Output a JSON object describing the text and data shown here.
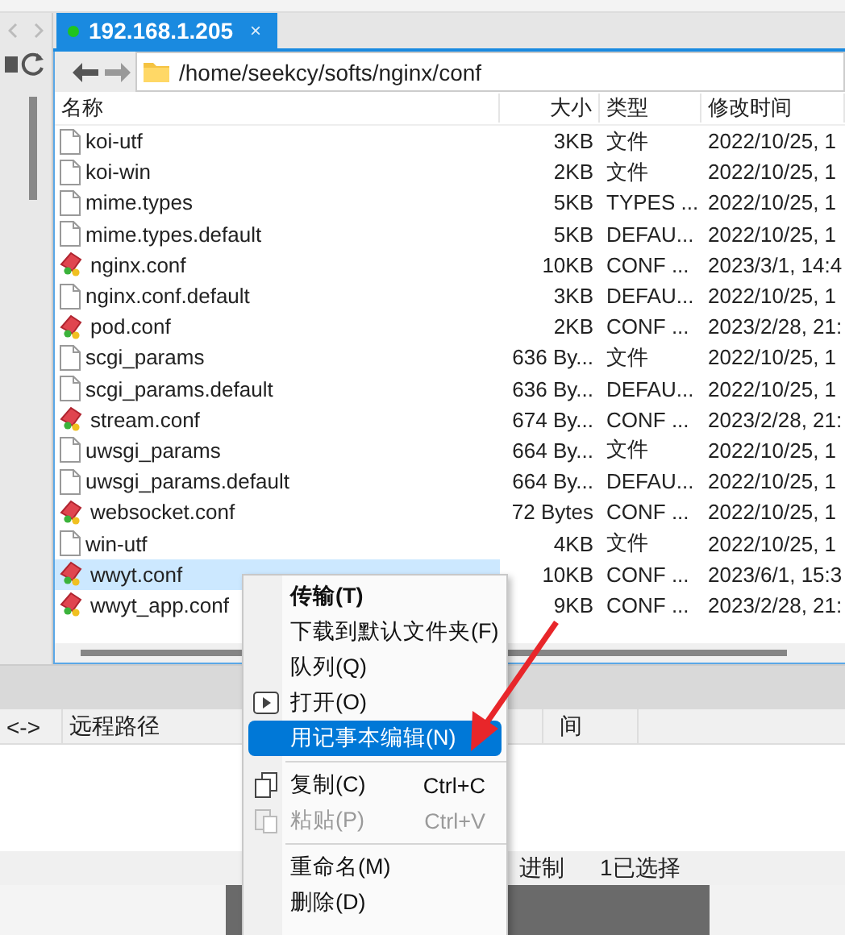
{
  "tab": {
    "title": "192.168.1.205",
    "connected": true,
    "close": "×"
  },
  "address": {
    "path": "/home/seekcy/softs/nginx/conf"
  },
  "table": {
    "columns": [
      "名称",
      "大小",
      "类型",
      "修改时间"
    ],
    "rows": [
      {
        "kind": "file",
        "name": "koi-utf",
        "size": "3KB",
        "type": "文件",
        "modified": "2022/10/25, 1",
        "selected": false
      },
      {
        "kind": "file",
        "name": "koi-win",
        "size": "2KB",
        "type": "文件",
        "modified": "2022/10/25, 1",
        "selected": false
      },
      {
        "kind": "file",
        "name": "mime.types",
        "size": "5KB",
        "type": "TYPES ...",
        "modified": "2022/10/25, 1",
        "selected": false
      },
      {
        "kind": "file",
        "name": "mime.types.default",
        "size": "5KB",
        "type": "DEFAU...",
        "modified": "2022/10/25, 1",
        "selected": false
      },
      {
        "kind": "conf",
        "name": "nginx.conf",
        "size": "10KB",
        "type": "CONF ...",
        "modified": "2023/3/1, 14:4",
        "selected": false
      },
      {
        "kind": "file",
        "name": "nginx.conf.default",
        "size": "3KB",
        "type": "DEFAU...",
        "modified": "2022/10/25, 1",
        "selected": false
      },
      {
        "kind": "conf",
        "name": "pod.conf",
        "size": "2KB",
        "type": "CONF ...",
        "modified": "2023/2/28, 21:",
        "selected": false
      },
      {
        "kind": "file",
        "name": "scgi_params",
        "size": "636 By...",
        "type": "文件",
        "modified": "2022/10/25, 1",
        "selected": false
      },
      {
        "kind": "file",
        "name": "scgi_params.default",
        "size": "636 By...",
        "type": "DEFAU...",
        "modified": "2022/10/25, 1",
        "selected": false
      },
      {
        "kind": "conf",
        "name": "stream.conf",
        "size": "674 By...",
        "type": "CONF ...",
        "modified": "2023/2/28, 21:",
        "selected": false
      },
      {
        "kind": "file",
        "name": "uwsgi_params",
        "size": "664 By...",
        "type": "文件",
        "modified": "2022/10/25, 1",
        "selected": false
      },
      {
        "kind": "file",
        "name": "uwsgi_params.default",
        "size": "664 By...",
        "type": "DEFAU...",
        "modified": "2022/10/25, 1",
        "selected": false
      },
      {
        "kind": "conf",
        "name": "websocket.conf",
        "size": "72 Bytes",
        "type": "CONF ...",
        "modified": "2022/10/25, 1",
        "selected": false
      },
      {
        "kind": "file",
        "name": "win-utf",
        "size": "4KB",
        "type": "文件",
        "modified": "2022/10/25, 1",
        "selected": false
      },
      {
        "kind": "conf",
        "name": "wwyt.conf",
        "size": "10KB",
        "type": "CONF ...",
        "modified": "2023/6/1, 15:3",
        "selected": true
      },
      {
        "kind": "conf",
        "name": "wwyt_app.conf",
        "size": "9KB",
        "type": "CONF ...",
        "modified": "2023/2/28, 21:",
        "selected": false
      }
    ]
  },
  "queue": {
    "columns": [
      "<->",
      "远程路径",
      "间"
    ]
  },
  "status_bar": {
    "items": [
      "进制",
      "1已选择"
    ]
  },
  "context_menu": {
    "items": [
      {
        "kind": "plain",
        "label": "传输(T)",
        "default": true,
        "selected": false,
        "disabled": false
      },
      {
        "kind": "plain",
        "label": "下载到默认文件夹(F)",
        "default": false,
        "selected": false,
        "disabled": false
      },
      {
        "kind": "plain",
        "label": "队列(Q)",
        "default": false,
        "selected": false,
        "disabled": false
      },
      {
        "kind": "play",
        "label": "打开(O)",
        "default": false,
        "selected": false,
        "disabled": false
      },
      {
        "kind": "plain",
        "label": "用记事本编辑(N)",
        "default": false,
        "selected": true,
        "disabled": false
      },
      {
        "kind": "separator"
      },
      {
        "kind": "copy",
        "label": "复制(C)",
        "shortcut": "Ctrl+C",
        "default": false,
        "selected": false,
        "disabled": false
      },
      {
        "kind": "paste",
        "label": "粘贴(P)",
        "shortcut": "Ctrl+V",
        "default": false,
        "selected": false,
        "disabled": true
      },
      {
        "kind": "separator"
      },
      {
        "kind": "plain",
        "label": "重命名(M)",
        "default": false,
        "selected": false,
        "disabled": false
      },
      {
        "kind": "plain",
        "label": "删除(D)",
        "default": false,
        "selected": false,
        "disabled": false
      }
    ]
  }
}
